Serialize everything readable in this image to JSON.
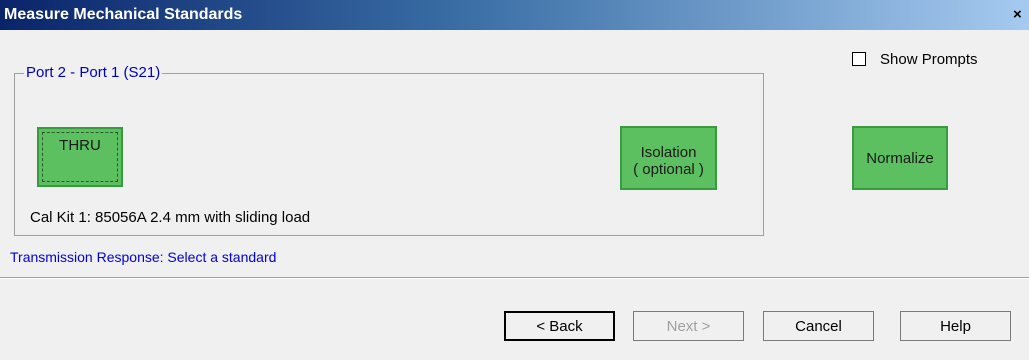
{
  "window": {
    "title": "Measure Mechanical Standards",
    "close_symbol": "×"
  },
  "options": {
    "show_prompts_label": "Show Prompts",
    "show_prompts_checked": false
  },
  "group": {
    "legend": "Port 2 - Port 1 (S21)",
    "standards": {
      "thru": "THRU",
      "isolation_line1": "Isolation",
      "isolation_line2": "( optional )"
    },
    "cal_kit": "Cal Kit 1: 85056A 2.4 mm with sliding load"
  },
  "normalize_label": "Normalize",
  "status_text": "Transmission Response: Select a standard",
  "buttons": {
    "back": "< Back",
    "next": "Next >",
    "cancel": "Cancel",
    "help": "Help"
  },
  "colors": {
    "standard_button": "#5cbf60",
    "status_text": "#0000dd",
    "group_legend": "#0000c0"
  }
}
